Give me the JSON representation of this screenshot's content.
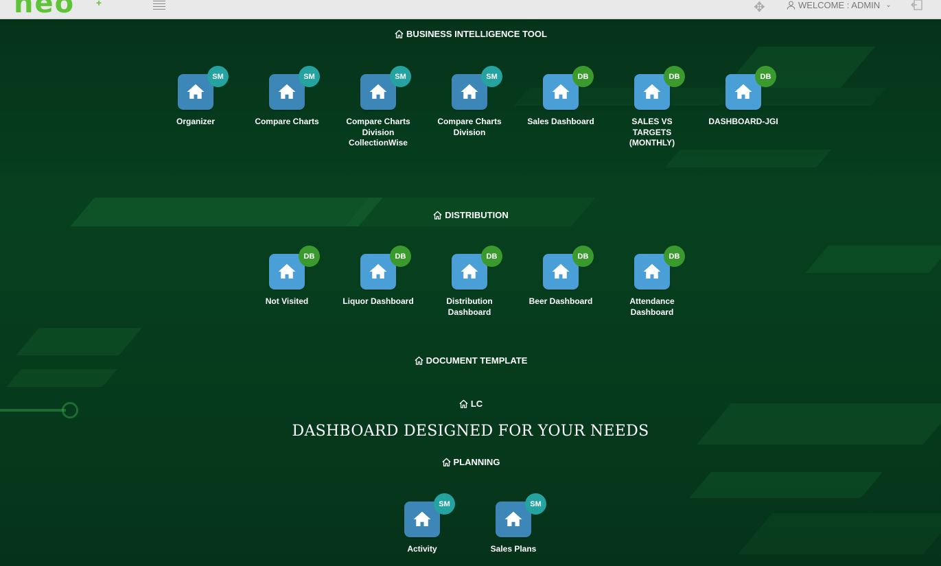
{
  "header": {
    "logo": "neo",
    "welcome": "WELCOME : ADMIN"
  },
  "sections": {
    "bi": {
      "title": "BUSINESS INTELLIGENCE TOOL",
      "tiles": [
        {
          "label": "Organizer",
          "badge": "SM"
        },
        {
          "label": "Compare Charts",
          "badge": "SM"
        },
        {
          "label": "Compare Charts Division CollectionWise",
          "badge": "SM"
        },
        {
          "label": "Compare Charts Division",
          "badge": "SM"
        },
        {
          "label": "Sales Dashboard",
          "badge": "DB"
        },
        {
          "label": "SALES VS TARGETS (MONTHLY)",
          "badge": "DB"
        },
        {
          "label": "DASHBOARD-JGI",
          "badge": "DB"
        }
      ]
    },
    "distribution": {
      "title": "DISTRIBUTION",
      "tiles": [
        {
          "label": "Not Visited",
          "badge": "DB"
        },
        {
          "label": "Liquor Dashboard",
          "badge": "DB"
        },
        {
          "label": "Distribution Dashboard",
          "badge": "DB"
        },
        {
          "label": "Beer Dashboard",
          "badge": "DB"
        },
        {
          "label": "Attendance Dashboard",
          "badge": "DB"
        }
      ]
    },
    "document_template": {
      "title": "DOCUMENT TEMPLATE"
    },
    "lc": {
      "title": "LC"
    },
    "tagline": "DASHBOARD DESIGNED FOR YOUR NEEDS",
    "planning": {
      "title": "PLANNING",
      "tiles": [
        {
          "label": "Activity",
          "badge": "SM"
        },
        {
          "label": "Sales Plans",
          "badge": "SM"
        }
      ]
    }
  },
  "colors": {
    "background": "#063618",
    "tile_blue": "#4a9fd6",
    "badge_sm": "#25a3a0",
    "badge_db": "#3a9a2e",
    "logo_green": "#5fc33a"
  }
}
